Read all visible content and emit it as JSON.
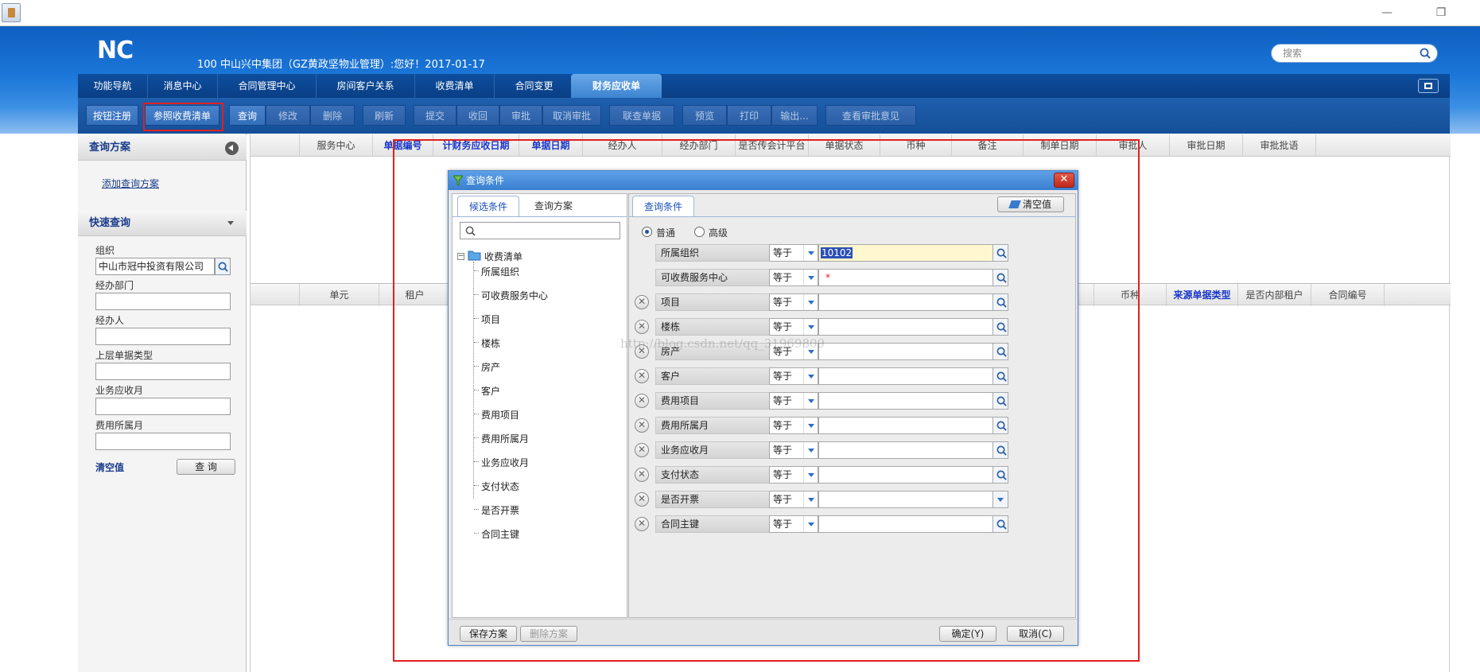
{
  "window": {
    "minimize": "—",
    "restore": "❐"
  },
  "header": {
    "logo": "NC",
    "welcome": "100 中山兴中集团（GZ黄政坚物业管理）:您好！2017-01-17",
    "search_placeholder": "搜索"
  },
  "nav": {
    "tabs": [
      "功能导航",
      "消息中心",
      "合同管理中心",
      "房间客户关系",
      "收费清单",
      "合同变更",
      "财务应收单"
    ],
    "active": "财务应收单"
  },
  "toolbar": {
    "buttons": [
      "按钮注册",
      "参照收费清单",
      "查询",
      "修改",
      "删除",
      "刷新",
      "提交",
      "收回",
      "审批",
      "取消审批",
      "联查单据",
      "预览",
      "打印",
      "输出...",
      "查看审批意见"
    ]
  },
  "left": {
    "query_scheme": "查询方案",
    "add_scheme": "添加查询方案",
    "quick_query": "快速查询",
    "fields": [
      {
        "label": "组织",
        "value": "中山市冠中投资有限公司"
      },
      {
        "label": "经办部门",
        "value": ""
      },
      {
        "label": "经办人",
        "value": ""
      },
      {
        "label": "上层单据类型",
        "value": ""
      },
      {
        "label": "业务应收月",
        "value": ""
      },
      {
        "label": "费用所属月",
        "value": ""
      }
    ],
    "clear": "清空值",
    "query": "查 询"
  },
  "grid1": {
    "cols": [
      "服务中心",
      "单据编号",
      "计财务应收日期",
      "单据日期",
      "经办人",
      "经办部门",
      "是否传会计平台",
      "单据状态",
      "币种",
      "备注",
      "制单日期",
      "审批人",
      "审批日期",
      "审批批语"
    ]
  },
  "grid2": {
    "cols": [
      "单元",
      "租户",
      "币种",
      "来源单据类型",
      "是否内部租户",
      "合同编号"
    ]
  },
  "dialog": {
    "title": "查询条件",
    "close": "✕",
    "left_tabs": [
      "候选条件",
      "查询方案"
    ],
    "tree_root": "收费清单",
    "tree_items": [
      "所属组织",
      "可收费服务中心",
      "项目",
      "楼栋",
      "房产",
      "客户",
      "费用项目",
      "费用所属月",
      "业务应收月",
      "支付状态",
      "是否开票",
      "合同主键"
    ],
    "right_tab": "查询条件",
    "clear_btn": "清空值",
    "radio_normal": "普通",
    "radio_adv": "高级",
    "conditions": [
      {
        "name": "所属组织",
        "op": "等于",
        "value": "10102"
      },
      {
        "name": "可收费服务中心",
        "op": "等于",
        "value": "*"
      },
      {
        "name": "项目",
        "op": "等于",
        "value": ""
      },
      {
        "name": "楼栋",
        "op": "等于",
        "value": ""
      },
      {
        "name": "房产",
        "op": "等于",
        "value": ""
      },
      {
        "name": "客户",
        "op": "等于",
        "value": ""
      },
      {
        "name": "费用项目",
        "op": "等于",
        "value": ""
      },
      {
        "name": "费用所属月",
        "op": "等于",
        "value": ""
      },
      {
        "name": "业务应收月",
        "op": "等于",
        "value": ""
      },
      {
        "name": "支付状态",
        "op": "等于",
        "value": ""
      },
      {
        "name": "是否开票",
        "op": "等于",
        "value": ""
      },
      {
        "name": "合同主键",
        "op": "等于",
        "value": ""
      }
    ],
    "save": "保存方案",
    "delete": "删除方案",
    "ok": "确定(Y)",
    "cancel": "取消(C)"
  },
  "watermark": "http://blog.csdn.net/qq_31969809"
}
